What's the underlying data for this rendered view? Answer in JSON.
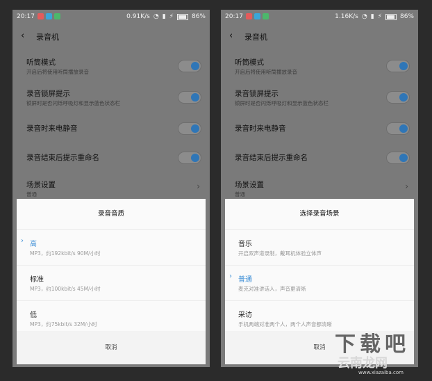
{
  "left": {
    "statusbar": {
      "time": "20:17",
      "speed": "0.91K/s",
      "battery": "86%"
    },
    "appbar": {
      "back": "‹",
      "title": "录音机"
    },
    "settings": [
      {
        "label": "听筒模式",
        "desc": "开启后将使用听筒播放录音",
        "toggle": true
      },
      {
        "label": "录音锁屏提示",
        "desc": "锁屏时是否闪烁呼吸灯和显示蓝色状态栏",
        "toggle": true
      },
      {
        "label": "录音时来电静音",
        "desc": "",
        "toggle": true
      },
      {
        "label": "录音结束后提示重命名",
        "desc": "",
        "toggle": true
      },
      {
        "label": "场景设置",
        "desc": "普通",
        "toggle": false
      }
    ],
    "dialog": {
      "title": "录音音质",
      "options": [
        {
          "label": "高",
          "desc": "MP3，约192kbit/s 90M/小时",
          "selected": true
        },
        {
          "label": "标准",
          "desc": "MP3，约100kbit/s 45M/小时",
          "selected": false
        },
        {
          "label": "低",
          "desc": "MP3，约75kbit/s 32M/小时",
          "selected": false
        }
      ],
      "cancel": "取消"
    }
  },
  "right": {
    "statusbar": {
      "time": "20:17",
      "speed": "1.16K/s",
      "battery": "86%"
    },
    "appbar": {
      "back": "‹",
      "title": "录音机"
    },
    "settings": [
      {
        "label": "听筒模式",
        "desc": "开启后将使用听筒播放录音",
        "toggle": true
      },
      {
        "label": "录音锁屏提示",
        "desc": "锁屏时是否闪烁呼吸灯和显示蓝色状态栏",
        "toggle": true
      },
      {
        "label": "录音时来电静音",
        "desc": "",
        "toggle": true
      },
      {
        "label": "录音结束后提示重命名",
        "desc": "",
        "toggle": true
      },
      {
        "label": "场景设置",
        "desc": "普通",
        "toggle": false
      }
    ],
    "dialog": {
      "title": "选择录音场景",
      "options": [
        {
          "label": "音乐",
          "desc": "开启双声道录制，戴耳机体验立体声",
          "selected": false
        },
        {
          "label": "普通",
          "desc": "麦克对准讲话人，声音更清晰",
          "selected": true
        },
        {
          "label": "采访",
          "desc": "手机两端对准两个人，两个人声音都清晰",
          "selected": false
        }
      ],
      "cancel": "取消"
    }
  },
  "watermark": {
    "big": "下载吧",
    "cn": "云南龙网",
    "url": "www.xiazaiba.com"
  },
  "colors": {
    "accent": "#3c8ed6",
    "toggle_knob": "#2f76b7",
    "overlay": "#7a7a7a"
  }
}
